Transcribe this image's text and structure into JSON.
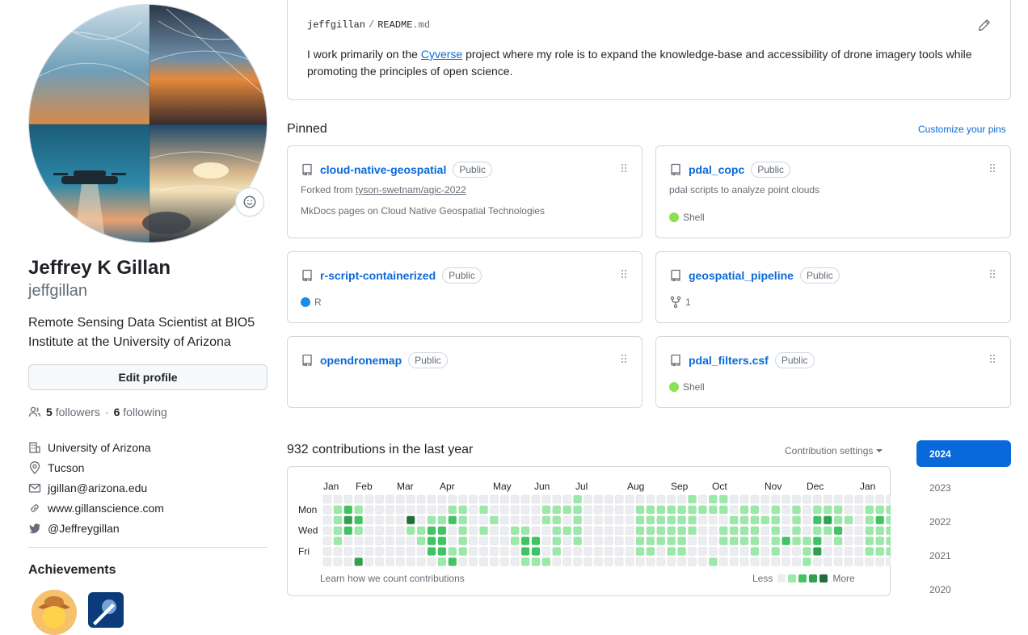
{
  "profile": {
    "full_name": "Jeffrey K Gillan",
    "username": "jeffgillan",
    "bio": "Remote Sensing Data Scientist at BIO5 Institute at the University of Arizona",
    "edit_profile_label": "Edit profile",
    "followers_count": "5",
    "followers_label": "followers",
    "following_count": "6",
    "following_label": "following",
    "separator": "·",
    "details": {
      "organization": "University of Arizona",
      "location": "Tucson",
      "email": "jgillan@arizona.edu",
      "website": "www.gillanscience.com",
      "twitter": "@Jeffreygillan"
    },
    "achievements_title": "Achievements"
  },
  "readme": {
    "owner": "jeffgillan",
    "separator": "/",
    "file_base": "README",
    "file_ext": ".md",
    "text_before": "I work primarily on the ",
    "link_text": "Cyverse",
    "text_after": " project where my role is to expand the knowledge-base and accessibility of drone imagery tools while promoting the principles of open science."
  },
  "pinned": {
    "title": "Pinned",
    "customize_label": "Customize your pins",
    "cards": [
      {
        "name": "cloud-native-geospatial",
        "visibility": "Public",
        "forked_prefix": "Forked from ",
        "forked_from": "tyson-swetnam/agic-2022",
        "description": "MkDocs pages on Cloud Native Geospatial Technologies"
      },
      {
        "name": "pdal_copc",
        "visibility": "Public",
        "description": "pdal scripts to analyze point clouds",
        "language": "Shell",
        "language_color": "#89e051"
      },
      {
        "name": "r-script-containerized",
        "visibility": "Public",
        "language": "R",
        "language_color": "#198ce7"
      },
      {
        "name": "geospatial_pipeline",
        "visibility": "Public",
        "forks": "1"
      },
      {
        "name": "opendronemap",
        "visibility": "Public"
      },
      {
        "name": "pdal_filters.csf",
        "visibility": "Public",
        "language": "Shell",
        "language_color": "#89e051"
      }
    ]
  },
  "contributions": {
    "title": "932 contributions in the last year",
    "settings_label": "Contribution settings",
    "months": [
      "Jan",
      "Feb",
      "Mar",
      "Apr",
      "May",
      "Jun",
      "Jul",
      "Aug",
      "Sep",
      "Oct",
      "Nov",
      "Dec",
      "Jan"
    ],
    "day_labels": [
      "Mon",
      "Wed",
      "Fri"
    ],
    "learn_label": "Learn how we count contributions",
    "legend_less": "Less",
    "legend_more": "More",
    "level_colors": [
      "#ebedf0",
      "#9be9a8",
      "#40c463",
      "#30a14e",
      "#216e39"
    ],
    "grid_weeks": [
      "0000000",
      "0111100",
      "0232000",
      "0121003",
      "0000000",
      "0000000",
      "0000000",
      "0000000",
      "0041000",
      "0001100",
      "0012220",
      "0012221",
      "0120012",
      "0111110",
      "0000000",
      "0101000",
      "0010000",
      "0000000",
      "0001100",
      "0001221",
      "0000221",
      "0110001",
      "0111110",
      "0101000",
      "1111100",
      "0000000",
      "0000000",
      "0000000",
      "0000000",
      "0000000",
      "0111110",
      "0111110",
      "0111100",
      "0111110",
      "0111110",
      "1111000",
      "0100000",
      "1100001",
      "1101100",
      "0011100",
      "0111100",
      "0111110",
      "0010000",
      "0111110",
      "0000200",
      "0111100",
      "0000111",
      "0121230",
      "0131000",
      "0112100",
      "0010000",
      "0000000",
      "0111110",
      "0121110",
      "0111110",
      "0000000",
      "1111100",
      "0000000",
      "0111110",
      "0111110",
      "0000000"
    ]
  },
  "years": [
    "2024",
    "2023",
    "2022",
    "2021",
    "2020"
  ],
  "active_year": "2024"
}
